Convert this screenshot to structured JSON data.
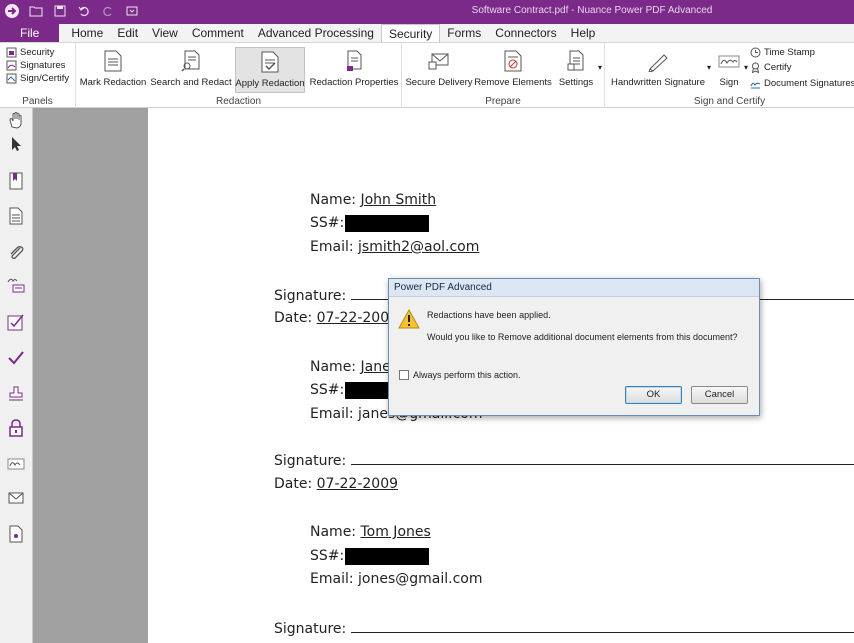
{
  "window": {
    "title": "Software Contract.pdf - Nuance Power PDF Advanced"
  },
  "menu": {
    "tabs": [
      {
        "label": "File"
      },
      {
        "label": "Home"
      },
      {
        "label": "Edit"
      },
      {
        "label": "View"
      },
      {
        "label": "Comment"
      },
      {
        "label": "Advanced Processing"
      },
      {
        "label": "Security"
      },
      {
        "label": "Forms"
      },
      {
        "label": "Connectors"
      },
      {
        "label": "Help"
      }
    ],
    "active": "Security"
  },
  "ribbon": {
    "panels": {
      "label": "Panels",
      "items": [
        {
          "label": "Security",
          "icon": "security-panel-icon"
        },
        {
          "label": "Signatures",
          "icon": "signatures-panel-icon"
        },
        {
          "label": "Sign/Certify",
          "icon": "sign-certify-panel-icon"
        }
      ]
    },
    "redaction": {
      "label": "Redaction",
      "buttons": [
        {
          "label": "Mark Redaction",
          "icon": "mark-redaction-icon"
        },
        {
          "label": "Search and Redact",
          "icon": "search-redact-icon"
        },
        {
          "label": "Apply Redaction",
          "icon": "apply-redaction-icon"
        },
        {
          "label": "Redaction Properties",
          "icon": "redaction-properties-icon"
        }
      ]
    },
    "prepare": {
      "label": "Prepare",
      "buttons": [
        {
          "label": "Secure Delivery",
          "icon": "secure-delivery-icon"
        },
        {
          "label": "Remove Elements",
          "icon": "remove-elements-icon"
        },
        {
          "label": "Settings",
          "icon": "settings-icon"
        }
      ]
    },
    "sign": {
      "label": "Sign and Certify",
      "buttons": [
        {
          "label": "Handwritten Signature",
          "icon": "pen-icon"
        },
        {
          "label": "Sign",
          "icon": "sign-icon"
        }
      ],
      "small": [
        {
          "label": "Time Stamp",
          "icon": "clock-icon"
        },
        {
          "label": "Certify",
          "icon": "certify-icon"
        },
        {
          "label": "Document Signatures",
          "icon": "doc-signatures-icon"
        }
      ]
    }
  },
  "document": {
    "records": [
      {
        "name_label": "Name:",
        "name": "John Smith",
        "ss_label": "SS#:",
        "email_label": "Email:",
        "email": "jsmith2@aol.com",
        "sig_label": "Signature:",
        "date_label": "Date:",
        "date": "07-22-2009"
      },
      {
        "name_label": "Name:",
        "name": "Jane",
        "ss_label": "SS#:",
        "email_label": "Email:",
        "email": "janes@gmail.com",
        "sig_label": "Signature:",
        "date_label": "Date:",
        "date": "07-22-2009"
      },
      {
        "name_label": "Name:",
        "name": "Tom Jones",
        "ss_label": "SS#:",
        "email_label": "Email:",
        "email": "jones@gmail.com",
        "sig_label": "Signature:"
      }
    ]
  },
  "dialog": {
    "title": "Power PDF Advanced",
    "message1": "Redactions have been applied.",
    "message2": "Would you like to Remove additional document elements from this document?",
    "checkbox_label": "Always perform this action.",
    "ok": "OK",
    "cancel": "Cancel"
  },
  "colors": {
    "accent": "#7b2a8a",
    "redaction": "#000000",
    "dialog_border": "#6a8fb5"
  }
}
